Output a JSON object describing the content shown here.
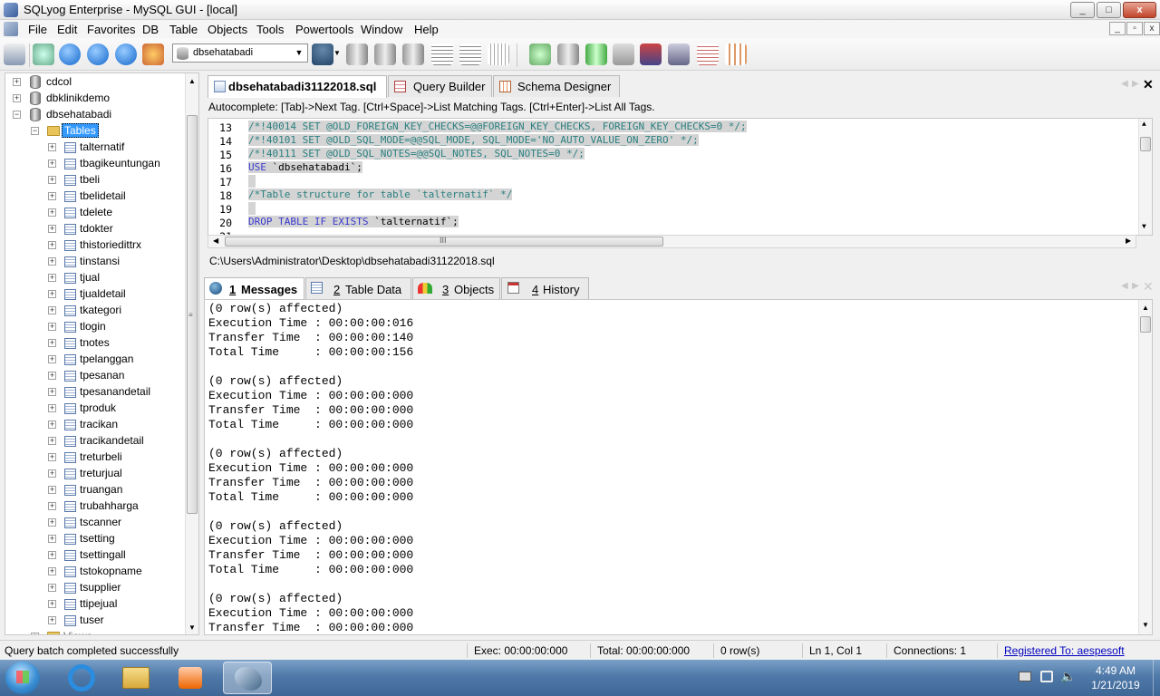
{
  "window": {
    "title": "SQLyog Enterprise - MySQL GUI - [local]",
    "controls": [
      "_",
      "□",
      "x"
    ],
    "mdi_controls": [
      "_",
      "▫",
      "x"
    ]
  },
  "menu": [
    "File",
    "Edit",
    "Favorites",
    "DB",
    "Table",
    "Objects",
    "Tools",
    "Powertools",
    "Window",
    "Help"
  ],
  "toolbar": {
    "db_selector": "dbsehatabadi"
  },
  "tree": {
    "databases": [
      "cdcol",
      "dbklinikdemo",
      "dbsehatabadi"
    ],
    "folder": "Tables",
    "tables": [
      "talternatif",
      "tbagikeuntungan",
      "tbeli",
      "tbelidetail",
      "tdelete",
      "tdokter",
      "thistoriedittrx",
      "tinstansi",
      "tjual",
      "tjualdetail",
      "tkategori",
      "tlogin",
      "tnotes",
      "tpelanggan",
      "tpesanan",
      "tpesanandetail",
      "tproduk",
      "tracikan",
      "tracikandetail",
      "treturbeli",
      "treturjual",
      "truangan",
      "trubahharga",
      "tscanner",
      "tsetting",
      "tsettingall",
      "tstokopname",
      "tsupplier",
      "ttipejual",
      "tuser"
    ],
    "partial_next": "Views"
  },
  "editor_tabs": [
    "dbsehatabadi31122018.sql",
    "Query Builder",
    "Schema Designer"
  ],
  "autocomplete_hint": "Autocomplete: [Tab]->Next Tag. [Ctrl+Space]->List Matching Tags. [Ctrl+Enter]->List All Tags.",
  "editor": {
    "lines": [
      {
        "n": "13",
        "text": "/*!40014 SET @OLD_FOREIGN_KEY_CHECKS=@@FOREIGN_KEY_CHECKS, FOREIGN_KEY_CHECKS=0 */;"
      },
      {
        "n": "14",
        "text": "/*!40101 SET @OLD_SQL_MODE=@@SQL_MODE, SQL_MODE='NO_AUTO_VALUE_ON_ZERO' */;"
      },
      {
        "n": "15",
        "text": "/*!40111 SET @OLD_SQL_NOTES=@@SQL_NOTES, SQL_NOTES=0 */;"
      },
      {
        "n": "16",
        "kw": "USE",
        "rest": " `dbsehatabadi`;"
      },
      {
        "n": "17",
        "text": ""
      },
      {
        "n": "18",
        "text": "/*Table structure for table `talternatif` */"
      },
      {
        "n": "19",
        "text": ""
      },
      {
        "n": "20",
        "kw": "DROP TABLE IF EXISTS",
        "rest": " `talternatif`;"
      }
    ],
    "partial_line": "21",
    "file_path": "C:\\Users\\Administrator\\Desktop\\dbsehatabadi31122018.sql",
    "hscroll_grip": "III"
  },
  "result_tabs": [
    {
      "num": "1",
      "label": "Messages"
    },
    {
      "num": "2",
      "label": "Table Data"
    },
    {
      "num": "3",
      "label": "Objects"
    },
    {
      "num": "4",
      "label": "History"
    }
  ],
  "messages": [
    "(0 row(s) affected)",
    "Execution Time : 00:00:00:016",
    "Transfer Time  : 00:00:00:140",
    "Total Time     : 00:00:00:156",
    "",
    "(0 row(s) affected)",
    "Execution Time : 00:00:00:000",
    "Transfer Time  : 00:00:00:000",
    "Total Time     : 00:00:00:000",
    "",
    "(0 row(s) affected)",
    "Execution Time : 00:00:00:000",
    "Transfer Time  : 00:00:00:000",
    "Total Time     : 00:00:00:000",
    "",
    "(0 row(s) affected)",
    "Execution Time : 00:00:00:000",
    "Transfer Time  : 00:00:00:000",
    "Total Time     : 00:00:00:000",
    "",
    "(0 row(s) affected)",
    "Execution Time : 00:00:00:000",
    "Transfer Time  : 00:00:00:000"
  ],
  "status": {
    "message": "Query batch completed successfully",
    "exec": "Exec: 00:00:00:000",
    "total": "Total: 00:00:00:000",
    "rows": "0 row(s)",
    "position": "Ln 1, Col 1",
    "connections": "Connections: 1",
    "registered": "Registered To: aespesoft"
  },
  "taskbar": {
    "time": "4:49 AM",
    "date": "1/21/2019"
  },
  "colors": {
    "selection": "#3399ff",
    "comment": "#2a7f7f",
    "keyword": "#3a3ad0",
    "link": "#0000c0"
  }
}
